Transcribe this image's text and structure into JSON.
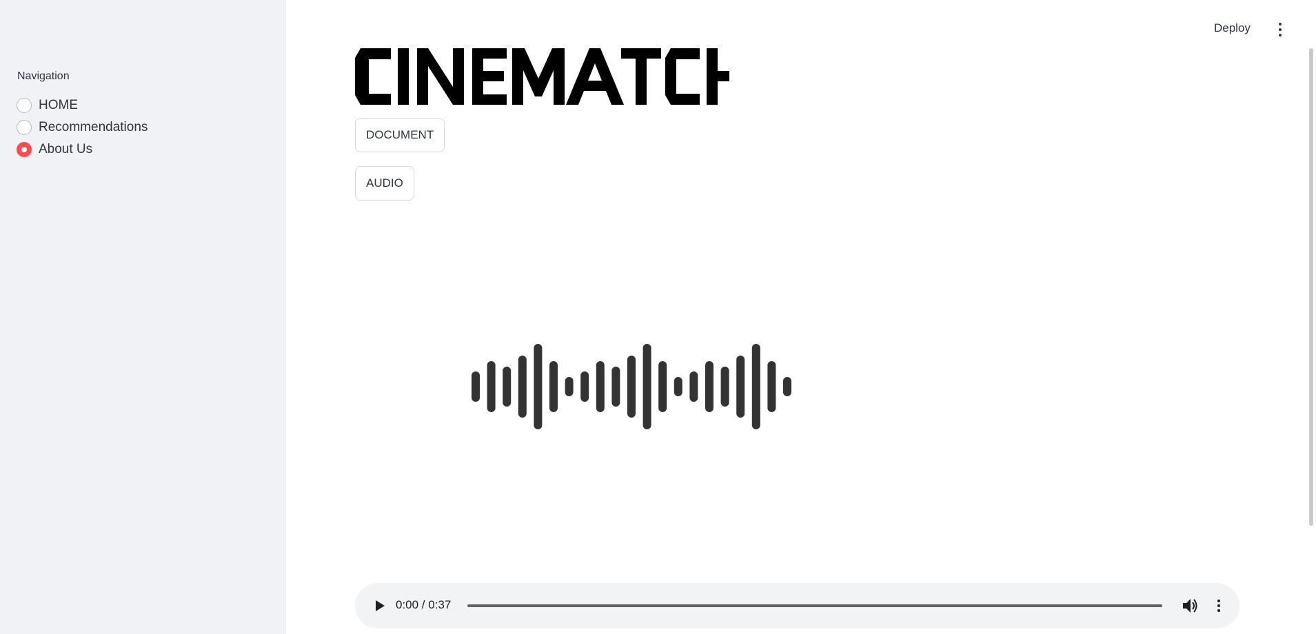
{
  "sidebar": {
    "nav_label": "Navigation",
    "options": [
      {
        "label": "HOME",
        "selected": false
      },
      {
        "label": "Recommendations",
        "selected": false
      },
      {
        "label": "About Us",
        "selected": true
      }
    ]
  },
  "header": {
    "deploy_label": "Deploy",
    "menu_icon": "kebab-menu-icon"
  },
  "main": {
    "logo_text": "CINEMATCH",
    "document_button": "DOCUMENT",
    "audio_button": "AUDIO",
    "waveform_icon": "sound-wave-icon",
    "audio_player": {
      "current_time": "0:00",
      "duration": "0:37",
      "time_display": "0:00 / 0:37",
      "progress": 0
    }
  },
  "colors": {
    "accent": "#ff4b4b",
    "sidebar_bg": "#f0f2f6",
    "text": "#31333f",
    "player_bg": "#f1f3f4"
  }
}
